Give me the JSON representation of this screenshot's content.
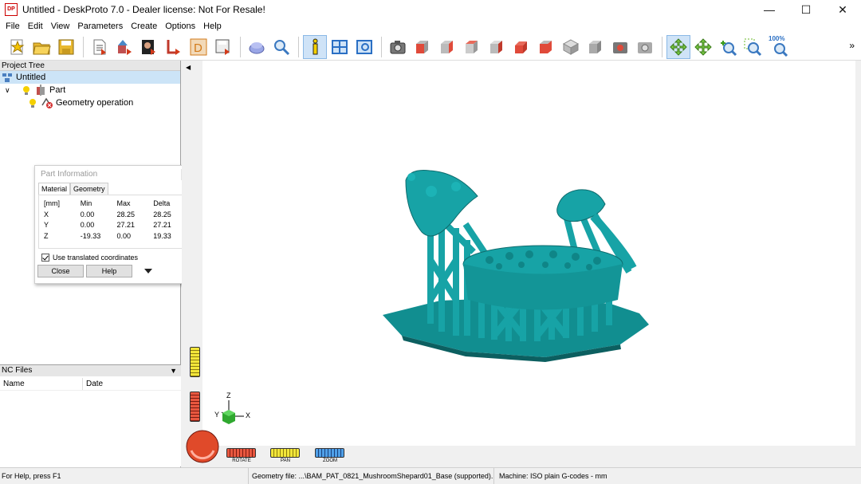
{
  "window": {
    "title": "Untitled - DeskProto 7.0 - Dealer license: Not For Resale!",
    "logo_text": "DP",
    "minimize_icon": "minimize-icon",
    "maximize_icon": "maximize-icon",
    "close_icon": "close-icon"
  },
  "menu": [
    "File",
    "Edit",
    "View",
    "Parameters",
    "Create",
    "Options",
    "Help"
  ],
  "toolbar": {
    "zoom_label": "100%"
  },
  "project_tree": {
    "header": "Project Tree",
    "root": "Untitled",
    "part": "Part",
    "operation": "Geometry operation"
  },
  "part_info": {
    "title": "Part Information",
    "tabs": [
      "Material",
      "Geometry"
    ],
    "headers": [
      "[mm]",
      "Min",
      "Max",
      "Delta"
    ],
    "rows": [
      [
        "X",
        "0.00",
        "28.25",
        "28.25"
      ],
      [
        "Y",
        "0.00",
        "27.21",
        "27.21"
      ],
      [
        "Z",
        "-19.33",
        "0.00",
        "19.33"
      ]
    ],
    "checkbox_label": "Use translated coordinates",
    "close_label": "Close",
    "help_label": "Help"
  },
  "nc_files": {
    "header": "NC Files",
    "columns": [
      "Name",
      "Date"
    ]
  },
  "axes": {
    "x": "X",
    "y": "Y",
    "z": "Z"
  },
  "wheels": {
    "rotate": "ROTATE",
    "pan": "PAN",
    "zoom": "ZOOM"
  },
  "status": {
    "help": "For Help, press F1",
    "geometry": "Geometry file: ...\\BAM_PAT_0821_MushroomShepard01_Base (supported).",
    "machine": "Machine: ISO plain G-codes - mm"
  },
  "colors": {
    "model": "#17a3a6",
    "model_shadow": "#0e6b6d",
    "base": "#118e90",
    "accent": "#0078d7"
  }
}
